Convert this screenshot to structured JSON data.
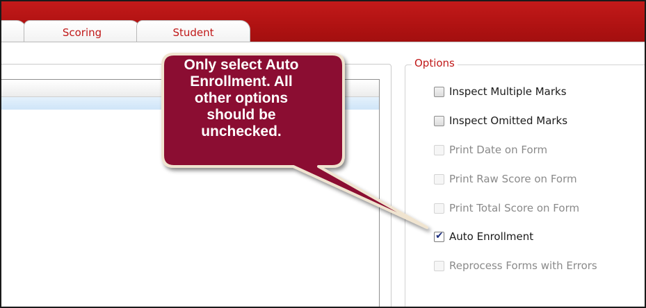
{
  "tabs": [
    {
      "label": ""
    },
    {
      "label": "Scoring"
    },
    {
      "label": "Student"
    }
  ],
  "options": {
    "legend": "Options",
    "items": [
      {
        "label": "Inspect Multiple Marks",
        "checked": false,
        "enabled": true
      },
      {
        "label": "Inspect Omitted Marks",
        "checked": false,
        "enabled": true
      },
      {
        "label": "Print Date on Form",
        "checked": false,
        "enabled": false
      },
      {
        "label": "Print Raw Score on Form",
        "checked": false,
        "enabled": false
      },
      {
        "label": "Print Total Score on Form",
        "checked": false,
        "enabled": false
      },
      {
        "label": "Auto Enrollment",
        "checked": true,
        "enabled": true
      },
      {
        "label": "Reprocess Forms with Errors",
        "checked": false,
        "enabled": false
      }
    ]
  },
  "callout": {
    "text": "Only select Auto Enrollment. All other options should be unchecked.",
    "lines": [
      "Only select Auto",
      "Enrollment. All",
      "other options",
      "should be",
      "unchecked."
    ]
  },
  "colors": {
    "header_red": "#b01212",
    "tab_text": "#c01818",
    "callout_fill": "#8b0f30",
    "callout_border": "#f0e4d0",
    "selection_row": "#d6e9f9"
  }
}
